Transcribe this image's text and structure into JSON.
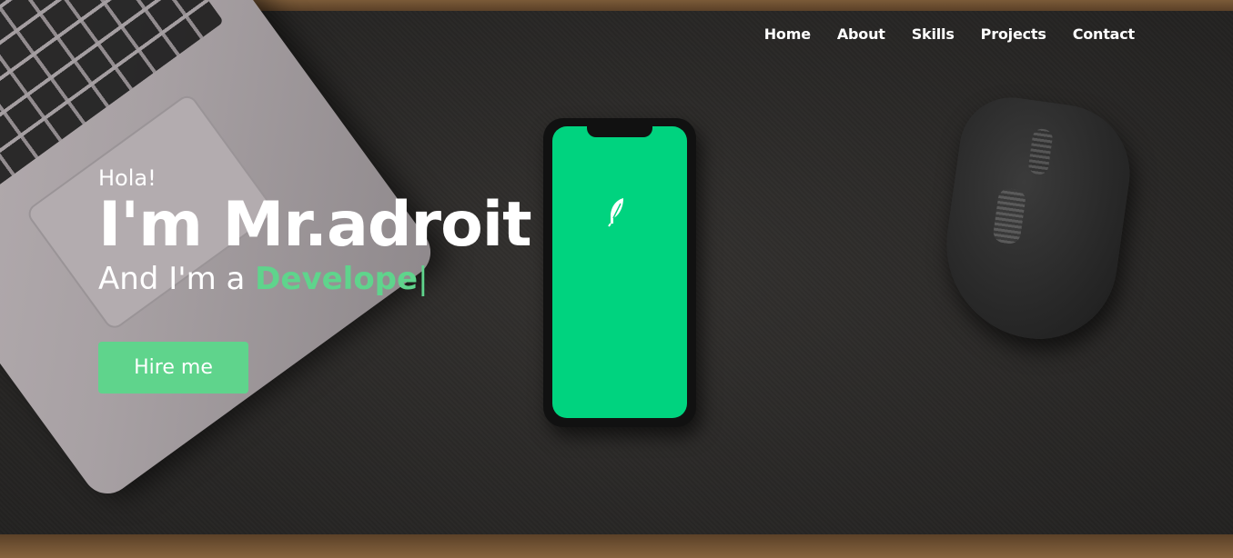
{
  "nav": {
    "items": [
      {
        "label": "Home"
      },
      {
        "label": "About"
      },
      {
        "label": "Skills"
      },
      {
        "label": "Projects"
      },
      {
        "label": "Contact"
      }
    ]
  },
  "hero": {
    "greeting": "Hola!",
    "title": "I'm Mr.adroit",
    "subtitle_prefix": "And I'm a",
    "typed_text": "Develope",
    "cursor": "|",
    "cta_label": "Hire me"
  },
  "colors": {
    "accent": "#5fd48c",
    "phone_screen": "#00d37f",
    "text": "#ffffff"
  },
  "icons": {
    "phone_app_icon": "feather-icon"
  }
}
